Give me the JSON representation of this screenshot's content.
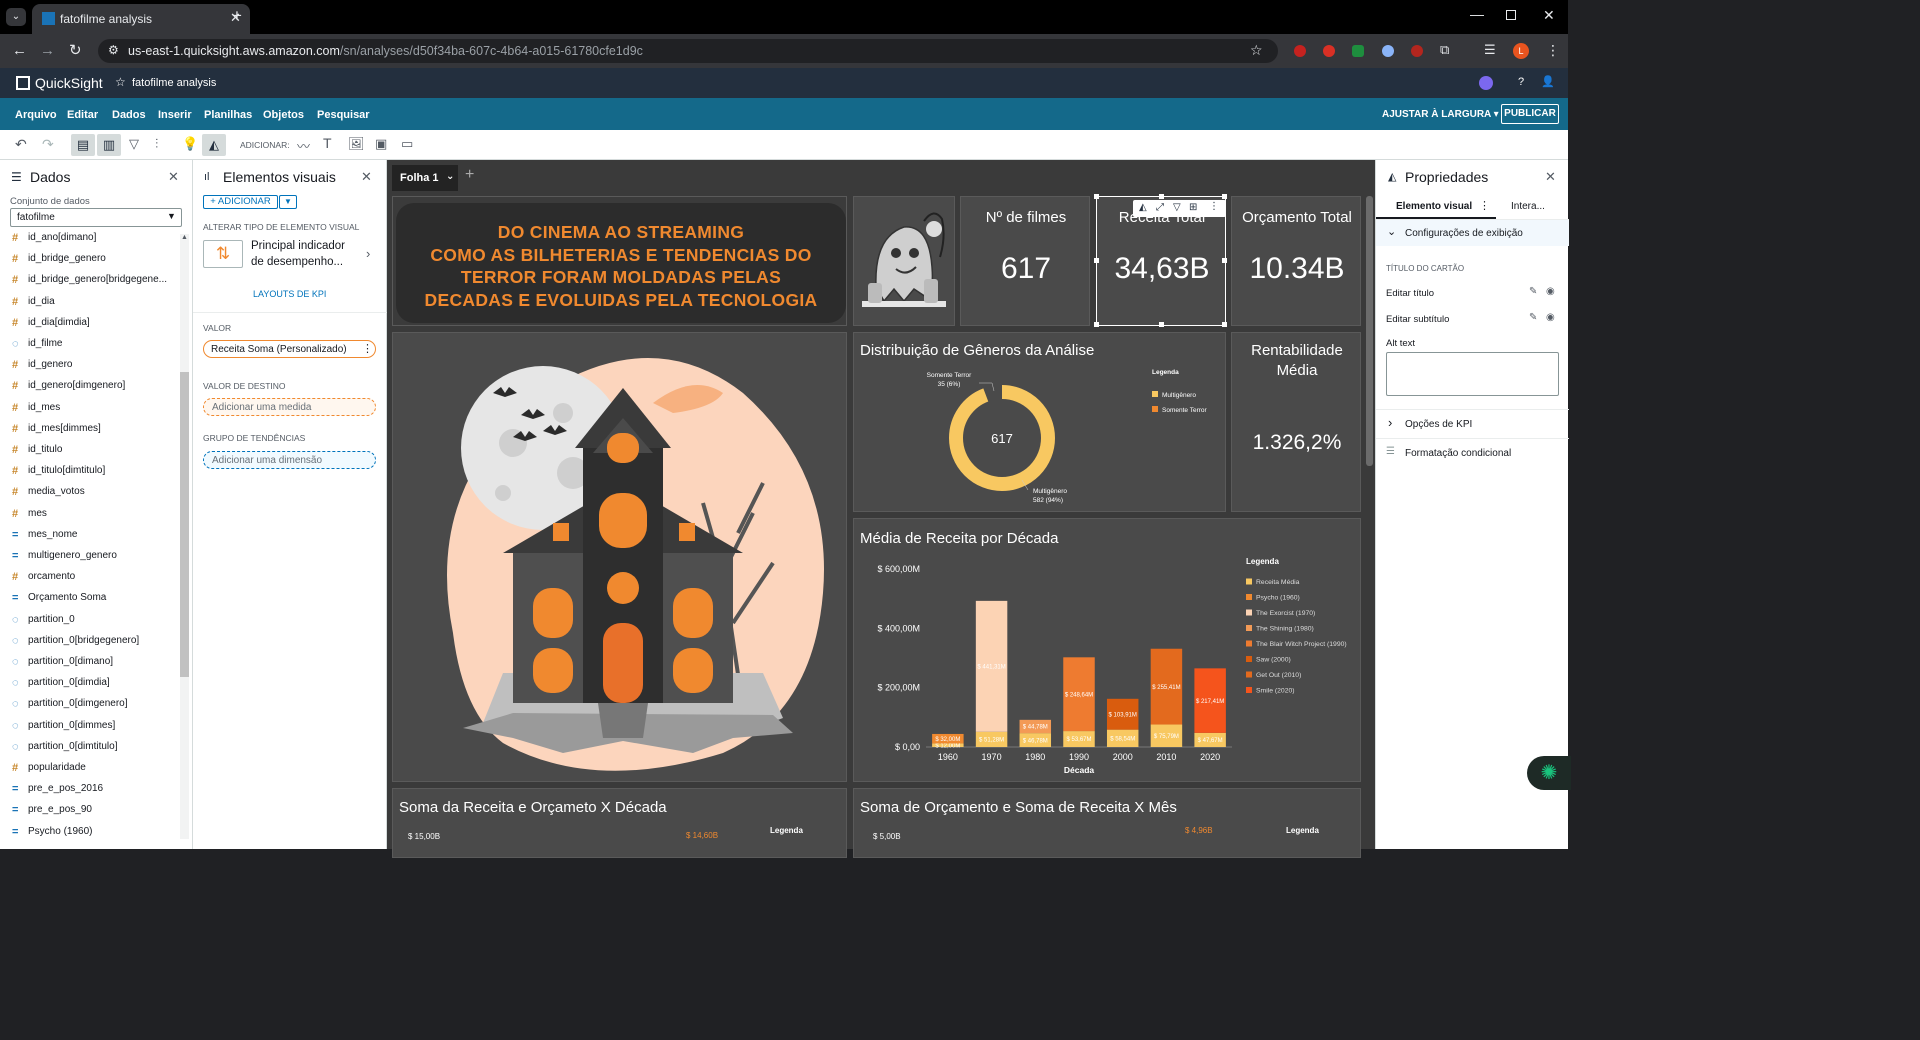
{
  "browser": {
    "tab_title": "fatofilme analysis",
    "url_host": "us-east-1.quicksight.aws.amazon.com",
    "url_path": "/sn/analyses/d50f34ba-607c-4b64-a015-61780cfe1d9c",
    "profile_initial": "L"
  },
  "qs": {
    "brand": "QuickSight",
    "analysis_name": "fatofilme analysis"
  },
  "menu": {
    "items": [
      "Arquivo",
      "Editar",
      "Dados",
      "Inserir",
      "Planilhas",
      "Objetos",
      "Pesquisar"
    ],
    "fit": "AJUSTAR À LARGURA",
    "publish": "PUBLICAR"
  },
  "toolbar": {
    "add_label": "ADICIONAR:"
  },
  "data_panel": {
    "title": "Dados",
    "dataset_label": "Conjunto de dados",
    "dataset": "fatofilme",
    "fields": [
      {
        "icon": "#",
        "name": "id_ano[dimano]"
      },
      {
        "icon": "#",
        "name": "id_bridge_genero"
      },
      {
        "icon": "#",
        "name": "id_bridge_genero[bridgegene..."
      },
      {
        "icon": "#",
        "name": "id_dia"
      },
      {
        "icon": "#",
        "name": "id_dia[dimdia]"
      },
      {
        "icon": "◌",
        "name": "id_filme"
      },
      {
        "icon": "#",
        "name": "id_genero"
      },
      {
        "icon": "#",
        "name": "id_genero[dimgenero]"
      },
      {
        "icon": "#",
        "name": "id_mes"
      },
      {
        "icon": "#",
        "name": "id_mes[dimmes]"
      },
      {
        "icon": "#",
        "name": "id_titulo"
      },
      {
        "icon": "#",
        "name": "id_titulo[dimtitulo]"
      },
      {
        "icon": "#",
        "name": "media_votos"
      },
      {
        "icon": "#",
        "name": "mes"
      },
      {
        "icon": "=",
        "name": "mes_nome"
      },
      {
        "icon": "=",
        "name": "multigenero_genero"
      },
      {
        "icon": "#",
        "name": "orcamento"
      },
      {
        "icon": "=",
        "name": "Orçamento Soma"
      },
      {
        "icon": "◌",
        "name": "partition_0"
      },
      {
        "icon": "◌",
        "name": "partition_0[bridgegenero]"
      },
      {
        "icon": "◌",
        "name": "partition_0[dimano]"
      },
      {
        "icon": "◌",
        "name": "partition_0[dimdia]"
      },
      {
        "icon": "◌",
        "name": "partition_0[dimgenero]"
      },
      {
        "icon": "◌",
        "name": "partition_0[dimmes]"
      },
      {
        "icon": "◌",
        "name": "partition_0[dimtitulo]"
      },
      {
        "icon": "#",
        "name": "popularidade"
      },
      {
        "icon": "=",
        "name": "pre_e_pos_2016"
      },
      {
        "icon": "=",
        "name": "pre_e_pos_90"
      },
      {
        "icon": "=",
        "name": "Psycho (1960)"
      }
    ]
  },
  "visual_panel": {
    "title": "Elementos visuais",
    "add": "+ ADICIONAR",
    "change_type_label": "ALTERAR TIPO DE ELEMENTO VISUAL",
    "visual_type_line1": "Principal indicador",
    "visual_type_line2": "de desempenho...",
    "kpi_layouts": "LAYOUTS DE KPI",
    "value_label": "VALOR",
    "value_field": "Receita Soma (Personalizado)",
    "target_label": "VALOR DE DESTINO",
    "target_placeholder": "Adicionar uma medida",
    "trend_label": "GRUPO DE TENDÊNCIAS",
    "trend_placeholder": "Adicionar uma dimensão"
  },
  "sheet": {
    "tab": "Folha 1"
  },
  "banner": {
    "lines": [
      "DO CINEMA AO STREAMING",
      "COMO AS BILHETERIAS E TENDENCIAS DO",
      "TERROR FORAM MOLDADAS PELAS",
      "DECADAS E EVOLUIDAS PELA TECNOLOGIA"
    ]
  },
  "kpis": {
    "films_title": "Nº de filmes",
    "films_value": "617",
    "revenue_title": "Receita Total",
    "revenue_value": "34,63B",
    "budget_title": "Orçamento Total",
    "budget_value": "10.34B",
    "profit_title_1": "Rentabilidade",
    "profit_title_2": "Média",
    "profit_value": "1.326,2%"
  },
  "donut": {
    "title": "Distribuição de Gêneros da Análise",
    "legend_title": "Legenda",
    "center": "617",
    "label_terror_1": "Somente Terror",
    "label_terror_2": "35 (6%)",
    "label_multi_1": "Multigênero",
    "label_multi_2": "582 (94%)"
  },
  "bar_panel": {
    "title": "Média de Receita por Década",
    "legend_title": "Legenda",
    "xlabel": "Década"
  },
  "bottom_left": {
    "title": "Soma da Receita e Orçameto X Década",
    "legend": "Legenda",
    "ytick": "$ 15,00B",
    "label": "$ 14,60B"
  },
  "bottom_right": {
    "title": "Soma de Orçamento e Soma de Receita X Mês",
    "legend": "Legenda",
    "ytick": "$ 5,00B",
    "label": "$ 4,96B"
  },
  "props": {
    "title": "Propriedades",
    "tab_visual": "Elemento visual",
    "tab_inter": "Intera...",
    "display_section": "Configurações de exibição",
    "card_title_label": "TÍTULO DO CARTÃO",
    "edit_title": "Editar título",
    "edit_subtitle": "Editar subtítulo",
    "alt_text": "Alt text",
    "kpi_options": "Opções de KPI",
    "conditional": "Formatação condicional"
  },
  "colors": {
    "qs_header": "#232f3e",
    "menu_bar": "#14698a",
    "accent_orange": "#f0892f",
    "card_bg": "#4a4a4a",
    "canvas_bg": "#3a3a3a"
  },
  "chart_data": [
    {
      "type": "pie",
      "title": "Distribuição de Gêneros da Análise",
      "categories": [
        "Multigênero",
        "Somente Terror"
      ],
      "values": [
        582,
        35
      ],
      "colors": [
        "#f8c861",
        "#f0892f"
      ],
      "legend": "top-right"
    },
    {
      "type": "bar",
      "title": "Média de Receita por Década",
      "xlabel": "Década",
      "ylabel": "",
      "categories": [
        "1960",
        "1970",
        "1980",
        "1990",
        "2000",
        "2010",
        "2020"
      ],
      "ylim": [
        0,
        600
      ],
      "yticks": [
        "$ 0,00",
        "$ 200,00M",
        "$ 400,00M",
        "$ 600,00M"
      ],
      "legend": "right",
      "series": [
        {
          "name": "Receita Média",
          "color": "#f8c861",
          "values": [
            12,
            51.28,
            46.78,
            53.67,
            58.54,
            75.79,
            47.67
          ],
          "labels": [
            "$ 12,00M",
            "$ 51,28M",
            "$ 46,78M",
            "$ 53,67M",
            "$ 58,54M",
            "$ 75,79M",
            "$ 47,67M"
          ]
        },
        {
          "name": "Psycho (1960)",
          "color": "#f0892f",
          "values": [
            32,
            0,
            0,
            0,
            0,
            0,
            0
          ],
          "labels": [
            "$ 32,00M",
            "",
            "",
            "",
            "",
            "",
            ""
          ]
        },
        {
          "name": "The Exorcist (1970)",
          "color": "#fcd3b4",
          "values": [
            0,
            441.31,
            0,
            0,
            0,
            0,
            0
          ],
          "labels": [
            "",
            "$ 441,31M",
            "",
            "",
            "",
            "",
            ""
          ]
        },
        {
          "name": "The Shining (1980)",
          "color": "#f39a56",
          "values": [
            0,
            0,
            44.78,
            0,
            0,
            0,
            0
          ],
          "labels": [
            "",
            "",
            "$ 44,78M",
            "",
            "",
            "",
            ""
          ]
        },
        {
          "name": "The Blair Witch Project (1990)",
          "color": "#ee7b30",
          "values": [
            0,
            0,
            0,
            248.64,
            0,
            0,
            0
          ],
          "labels": [
            "",
            "",
            "",
            "$ 248,64M",
            "",
            "",
            ""
          ]
        },
        {
          "name": "Saw (2000)",
          "color": "#d95c0e",
          "values": [
            0,
            0,
            0,
            0,
            103.91,
            0,
            0
          ],
          "labels": [
            "",
            "",
            "",
            "",
            "$ 103,91M",
            "",
            ""
          ]
        },
        {
          "name": "Get Out (2010)",
          "color": "#e36a1e",
          "values": [
            0,
            0,
            0,
            0,
            0,
            255.41,
            0
          ],
          "labels": [
            "",
            "",
            "",
            "",
            "",
            "$ 255,41M",
            ""
          ]
        },
        {
          "name": "Smile (2020)",
          "color": "#f5541c",
          "values": [
            0,
            0,
            0,
            0,
            0,
            0,
            217.41
          ],
          "labels": [
            "",
            "",
            "",
            "",
            "",
            "",
            "$ 217,41M"
          ]
        }
      ]
    }
  ]
}
